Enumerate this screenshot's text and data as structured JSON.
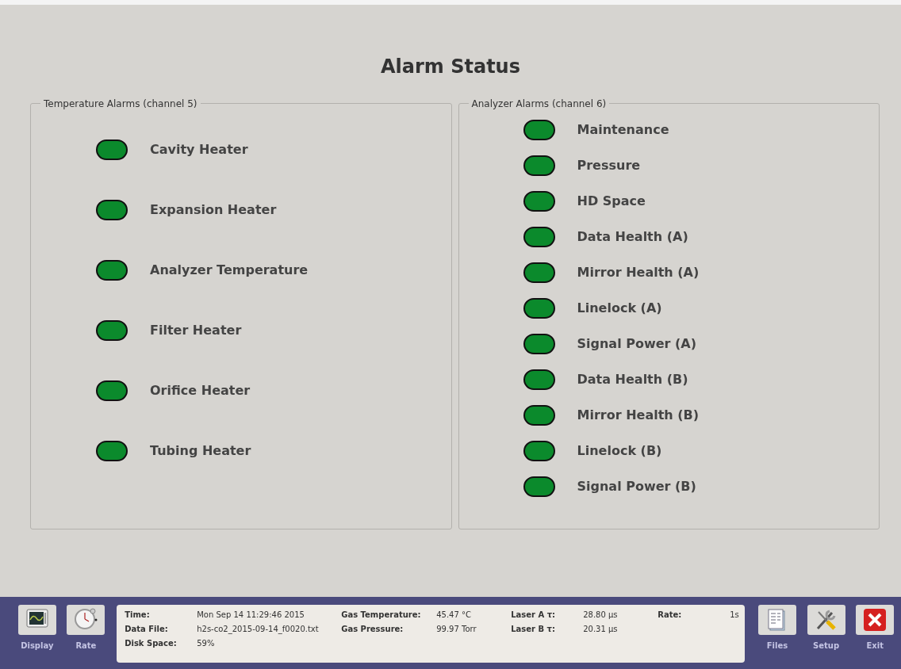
{
  "title": "Alarm Status",
  "sections": [
    {
      "title": "Temperature Alarms (channel 5)",
      "kind": "spread",
      "items": [
        {
          "label": "Cavity Heater",
          "color": "#0b8a2c"
        },
        {
          "label": "Expansion Heater",
          "color": "#0b8a2c"
        },
        {
          "label": "Analyzer Temperature",
          "color": "#0b8a2c"
        },
        {
          "label": "Filter Heater",
          "color": "#0b8a2c"
        },
        {
          "label": "Orifice Heater",
          "color": "#0b8a2c"
        },
        {
          "label": "Tubing Heater",
          "color": "#0b8a2c"
        }
      ]
    },
    {
      "title": "Analyzer Alarms (channel 6)",
      "kind": "compact",
      "items": [
        {
          "label": "Maintenance",
          "color": "#0b8a2c"
        },
        {
          "label": "Pressure",
          "color": "#0b8a2c"
        },
        {
          "label": "HD Space",
          "color": "#0b8a2c"
        },
        {
          "label": "Data Health (A)",
          "color": "#0b8a2c"
        },
        {
          "label": "Mirror Health (A)",
          "color": "#0b8a2c"
        },
        {
          "label": "Linelock (A)",
          "color": "#0b8a2c"
        },
        {
          "label": "Signal Power (A)",
          "color": "#0b8a2c"
        },
        {
          "label": "Data Health (B)",
          "color": "#0b8a2c"
        },
        {
          "label": "Mirror Health (B)",
          "color": "#0b8a2c"
        },
        {
          "label": "Linelock (B)",
          "color": "#0b8a2c"
        },
        {
          "label": "Signal Power (B)",
          "color": "#0b8a2c"
        }
      ]
    }
  ],
  "status_bar": {
    "left_buttons": [
      {
        "label": "Display",
        "kind": "display"
      },
      {
        "label": "Rate",
        "kind": "clock"
      }
    ],
    "info_columns": [
      [
        {
          "label": "Time:",
          "value": "Mon Sep 14 11:29:46 2015"
        },
        {
          "label": "Data File:",
          "value": "h2s-co2_2015-09-14_f0020.txt"
        },
        {
          "label": "Disk Space:",
          "value": "59%"
        }
      ],
      [
        {
          "label": "Gas Temperature:",
          "value": "45.47 °C"
        },
        {
          "label": "Gas Pressure:",
          "value": "99.97 Torr"
        }
      ],
      [
        {
          "label": "Laser A τ:",
          "value": "28.80 µs"
        },
        {
          "label": "Laser B τ:",
          "value": "20.31 µs"
        }
      ],
      [
        {
          "label": "Rate:",
          "value": "1s"
        }
      ]
    ],
    "right_buttons": [
      {
        "label": "Files",
        "kind": "files"
      },
      {
        "label": "Setup",
        "kind": "tools"
      },
      {
        "label": "Exit",
        "kind": "exit"
      }
    ]
  }
}
